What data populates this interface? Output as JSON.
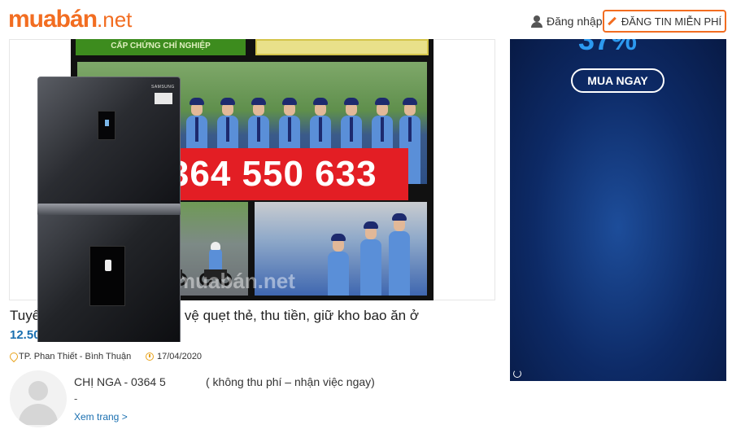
{
  "header": {
    "logo_main": "muabán",
    "logo_tld": ".net",
    "login_label": "Đăng nhập",
    "post_button_label": "ĐĂNG TIN MIỄN PHÍ"
  },
  "listing": {
    "image": {
      "top_strip_text": "CẤP CHỨNG CHỈ NGHIỆP",
      "phone_text": "0364 550 633",
      "watermark_text": "muabán.net"
    },
    "title": "Tuyển trực tiếp nam nữ bảo vệ quẹt thẻ, thu tiền, giữ kho bao ăn ở",
    "price": "12.500.000 đ",
    "location": "TP. Phan Thiết - Bình Thuận",
    "date": "17/04/2020"
  },
  "seller": {
    "name": "CHỊ NGA - 0364 5",
    "note": "( không thu phí – nhận việc ngay)",
    "dash": "-",
    "see_more_label": "Xem trang >"
  },
  "ad": {
    "percent_text": "37%",
    "buy_button_label": "MUA NGAY",
    "brand_text": "SAMSUNG"
  },
  "colors": {
    "brand_orange": "#f26d21",
    "price_blue": "#1a6fb0",
    "phone_red": "#e31e24",
    "ad_navy": "#0d2a66"
  }
}
